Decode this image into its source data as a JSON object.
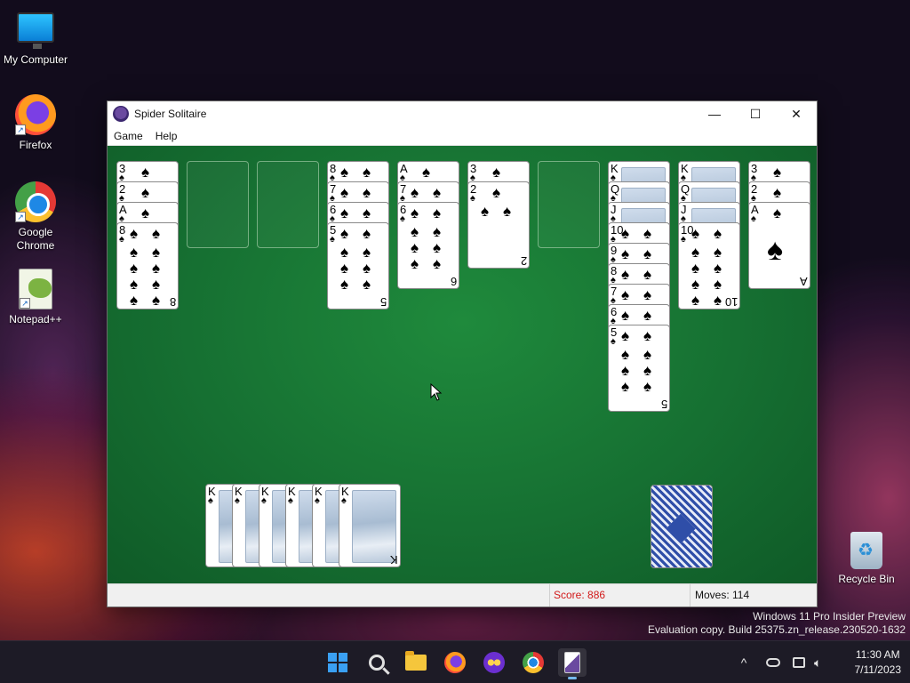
{
  "desktop": {
    "icons": [
      {
        "label": "My Computer",
        "icon": "monitor-icon"
      },
      {
        "label": "Firefox",
        "icon": "firefox-icon"
      },
      {
        "label": "Google Chrome",
        "icon": "chrome-icon"
      },
      {
        "label": "Notepad++",
        "icon": "notepadpp-icon"
      },
      {
        "label": "Recycle Bin",
        "icon": "recycle-bin-icon"
      }
    ],
    "shortcut_arrow": "↗",
    "watermark_line1": "Windows 11 Pro Insider Preview",
    "watermark_line2": "Evaluation copy. Build 25375.zn_release.230520-1632"
  },
  "window": {
    "title": "Spider Solitaire",
    "minimize_glyph": "—",
    "maximize_glyph": "☐",
    "close_glyph": "✕",
    "menu": [
      "Game",
      "Help"
    ]
  },
  "game": {
    "suit_symbol": "♠",
    "tableau": [
      {
        "face_down": 0,
        "cards": [
          "3",
          "2",
          "A",
          "8"
        ]
      },
      {
        "face_down": 0,
        "cards": []
      },
      {
        "face_down": 0,
        "cards": []
      },
      {
        "face_down": 0,
        "cards": [
          "8",
          "7",
          "6",
          "5"
        ]
      },
      {
        "face_down": 0,
        "cards": [
          "A",
          "7",
          "6"
        ]
      },
      {
        "face_down": 0,
        "cards": [
          "3",
          "2"
        ]
      },
      {
        "face_down": 0,
        "cards": []
      },
      {
        "face_down": 0,
        "cards": [
          "K",
          "Q",
          "J",
          "10",
          "9",
          "8",
          "7",
          "6",
          "5"
        ]
      },
      {
        "face_down": 0,
        "cards": [
          "K",
          "Q",
          "J",
          "10"
        ]
      },
      {
        "face_down": 0,
        "cards": [
          "3",
          "2",
          "A"
        ]
      }
    ],
    "face_cards_shown": [
      "K",
      "Q",
      "J"
    ],
    "completed_foundations": [
      "K",
      "K",
      "K",
      "K",
      "K",
      "K"
    ],
    "stock_piles": 1
  },
  "status": {
    "score": "Score: 886",
    "moves": "Moves:  114"
  },
  "taskbar": {
    "apps": [
      "start-icon",
      "search-icon",
      "file-explorer-icon",
      "firefox-icon",
      "app-mask-icon",
      "chrome-icon",
      "spider-solitaire-icon"
    ],
    "tray_chevron": "^",
    "time": "11:30 AM",
    "date": "7/11/2023"
  },
  "colors": {
    "felt": "#167032",
    "score_text": "#d21a1a",
    "accent": "#3aa0f3"
  }
}
